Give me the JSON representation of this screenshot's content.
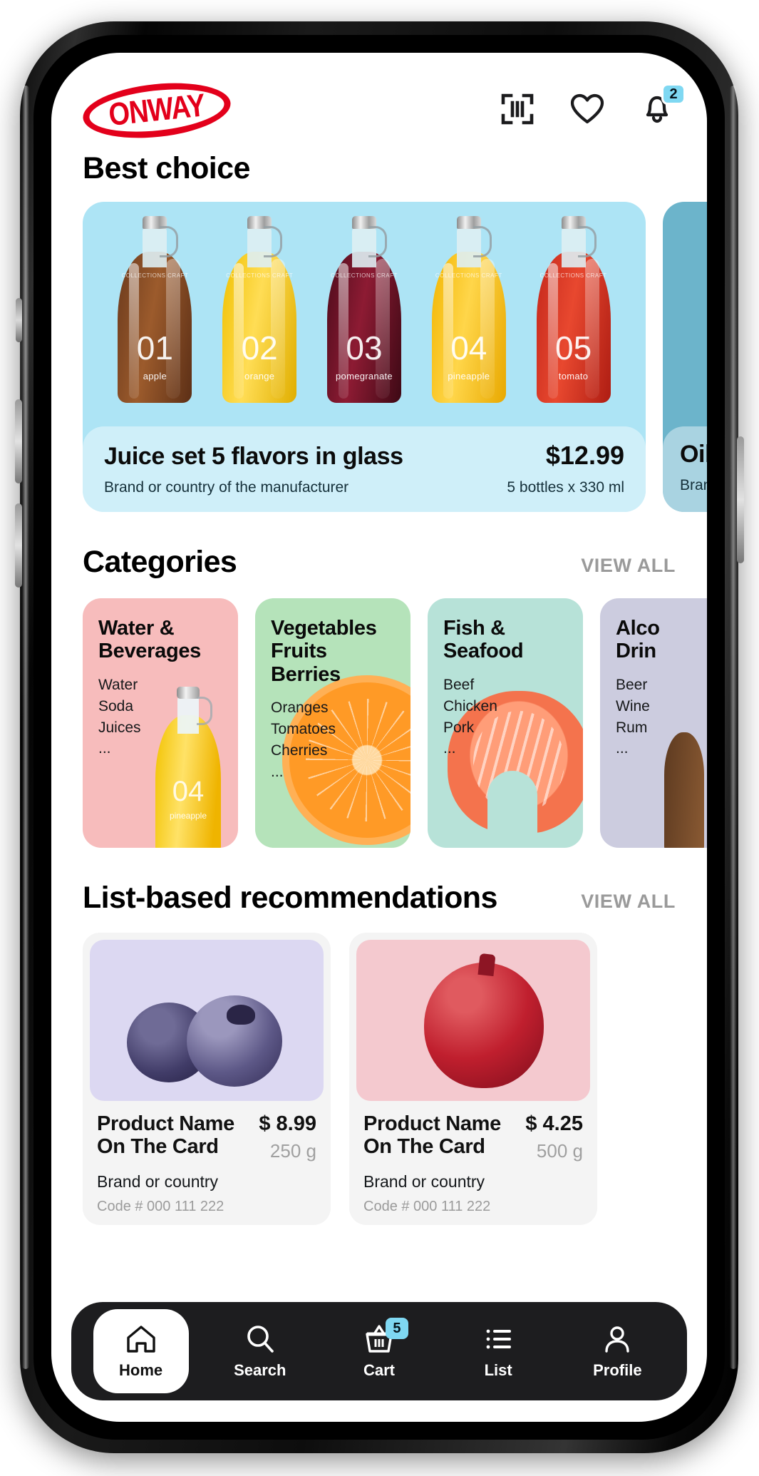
{
  "header": {
    "logo_text": "ONWAY",
    "icons": [
      {
        "name": "barcode-scan-icon"
      },
      {
        "name": "heart-icon"
      },
      {
        "name": "bell-icon",
        "badge": "2"
      }
    ]
  },
  "best_choice": {
    "title": "Best choice",
    "cards": [
      {
        "name": "Juice set 5 flavors in glass",
        "price": "$12.99",
        "subtitle": "Brand or country of the manufacturer",
        "quantity": "5 bottles x 330 ml",
        "bottles": [
          {
            "num": "01",
            "flavor": "apple",
            "color": "#6b3a1d",
            "color2": "#9c5b2c"
          },
          {
            "num": "02",
            "flavor": "orange",
            "color": "#f0c000",
            "color2": "#ffdd55"
          },
          {
            "num": "03",
            "flavor": "pomegranate",
            "color": "#5a0f20",
            "color2": "#8d1b33"
          },
          {
            "num": "04",
            "flavor": "pineapple",
            "color": "#f2b500",
            "color2": "#ffd64a"
          },
          {
            "num": "05",
            "flavor": "tomato",
            "color": "#c4281c",
            "color2": "#e8482f"
          }
        ],
        "brand_lines": "COLLECTIONS\nCRAFT"
      },
      {
        "name": "Oil",
        "subtitle": "Brand"
      }
    ]
  },
  "categories": {
    "title": "Categories",
    "view_all": "VIEW ALL",
    "items": [
      {
        "title": "Water &\nBeverages",
        "list": "Water\nSoda\nJuices\n...",
        "bg": "#f7bcbc",
        "art": "bottle",
        "art_num": "04",
        "art_label": "pineapple"
      },
      {
        "title": "Vegetables\nFruits\nBerries",
        "list": "Oranges\nTomatoes\nCherries\n...",
        "bg": "#b5e3ba",
        "art": "orange"
      },
      {
        "title": "Fish &\nSeafood",
        "list": "Beef\nChicken\nPork\n...",
        "bg": "#b7e2d8",
        "art": "salmon"
      },
      {
        "title": "Alco\nDrin",
        "list": "Beer\nWine\nRum\n...",
        "bg": "#ccccdf",
        "art": "duo"
      }
    ]
  },
  "recommendations": {
    "title": "List-based recommendations",
    "view_all": "VIEW ALL",
    "items": [
      {
        "name": "Product Name\nOn The Card",
        "price": "$ 8.99",
        "weight": "250 g",
        "brand": "Brand or country",
        "code": "Code # 000 111 222",
        "image": "blueberries",
        "image_bg": "#dcd8f2"
      },
      {
        "name": "Product Name\nOn The Card",
        "price": "$ 4.25",
        "weight": "500 g",
        "brand": "Brand or country",
        "code": "Code # 000 111 222",
        "image": "pomegranate",
        "image_bg": "#f4c9cf"
      }
    ]
  },
  "tabbar": {
    "items": [
      {
        "label": "Home",
        "icon": "home-icon",
        "active": true
      },
      {
        "label": "Search",
        "icon": "search-icon",
        "active": false
      },
      {
        "label": "Cart",
        "icon": "cart-icon",
        "active": false,
        "badge": "5"
      },
      {
        "label": "List",
        "icon": "list-icon",
        "active": false
      },
      {
        "label": "Profile",
        "icon": "profile-icon",
        "active": false
      }
    ]
  },
  "colors": {
    "brand_red": "#e3001b",
    "hero_blue": "#ade4f5",
    "hero_blue_alt": "#6cb4cb",
    "badge_blue": "#7fd8f2",
    "nav_dark": "#1d1d1f"
  }
}
